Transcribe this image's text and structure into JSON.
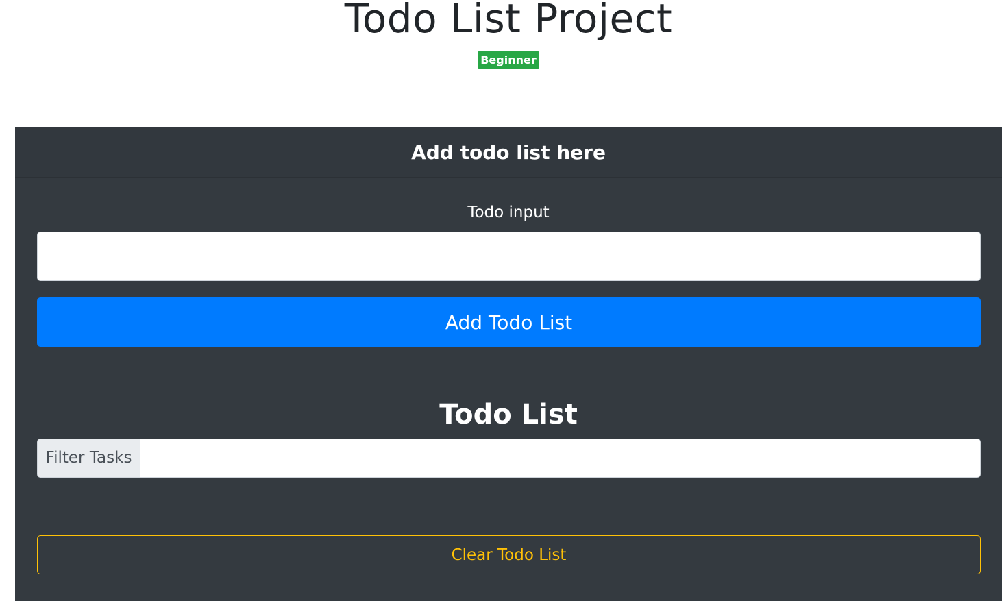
{
  "header": {
    "title": "Todo List Project",
    "badge": "Beginner"
  },
  "card": {
    "header_title": "Add todo list here",
    "todo_input_label": "Todo input",
    "todo_input_value": "",
    "add_button_label": "Add Todo List",
    "list_title": "Todo List",
    "filter_label": "Filter Tasks",
    "filter_value": "",
    "clear_button_label": "Clear Todo List"
  },
  "colors": {
    "card_background": "#343a40",
    "badge_success": "#28a745",
    "primary_button": "#007bff",
    "warning_outline": "#ffc107"
  }
}
